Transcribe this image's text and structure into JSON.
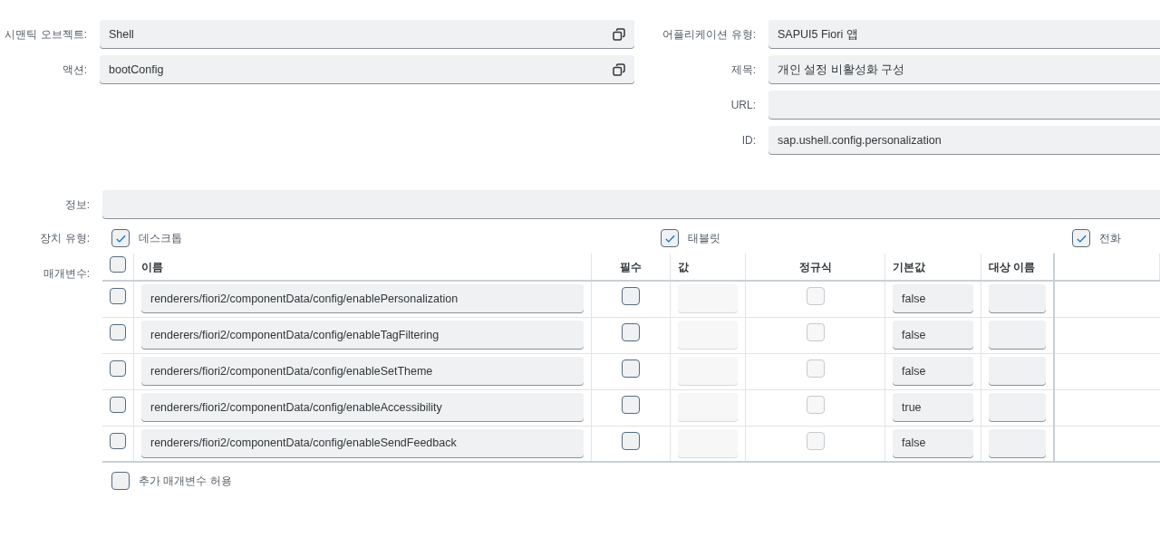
{
  "left_fields": [
    {
      "label": "시맨틱 오브젝트:",
      "value": "Shell",
      "has_copy_icon": true
    },
    {
      "label": "액션:",
      "value": "bootConfig",
      "has_copy_icon": true
    }
  ],
  "right_fields": [
    {
      "label": "어플리케이션 유형:",
      "value": "SAPUI5 Fiori 앱"
    },
    {
      "label": "제목:",
      "value": "개인 설정 비활성화 구성"
    },
    {
      "label": "URL:"
    },
    {
      "label": "ID:",
      "value": "sap.ushell.config.personalization"
    }
  ],
  "info": {
    "label": "정보:"
  },
  "device_types": {
    "label": "장치 유형:",
    "options": [
      {
        "label": "데스크톱",
        "checked": true
      },
      {
        "label": "태블릿",
        "checked": true
      },
      {
        "label": "전화",
        "checked": true
      }
    ]
  },
  "parameters": {
    "label": "매개변수:",
    "select_all_checked": false,
    "columns": [
      "이름",
      "필수",
      "값",
      "정규식",
      "기본값",
      "대상 이름"
    ],
    "rows": [
      {
        "selected": false,
        "name": "renderers/fiori2/componentData/config/enablePersonalization",
        "required": false,
        "value_disabled": true,
        "regex_checked": false,
        "regex_disabled": true,
        "default_value": "false"
      },
      {
        "selected": false,
        "name": "renderers/fiori2/componentData/config/enableTagFiltering",
        "required": false,
        "value_disabled": true,
        "regex_checked": false,
        "regex_disabled": true,
        "default_value": "false"
      },
      {
        "selected": false,
        "name": "renderers/fiori2/componentData/config/enableSetTheme",
        "required": false,
        "value_disabled": true,
        "regex_checked": false,
        "regex_disabled": true,
        "default_value": "false"
      },
      {
        "selected": false,
        "name": "renderers/fiori2/componentData/config/enableAccessibility",
        "required": false,
        "value_disabled": true,
        "regex_checked": false,
        "regex_disabled": true,
        "default_value": "true"
      },
      {
        "selected": false,
        "name": "renderers/fiori2/componentData/config/enableSendFeedback",
        "required": false,
        "value_disabled": true,
        "regex_checked": false,
        "regex_disabled": true,
        "default_value": "false"
      }
    ]
  },
  "allow_additional": {
    "label": "추가 매개변수 허용",
    "checked": false
  }
}
